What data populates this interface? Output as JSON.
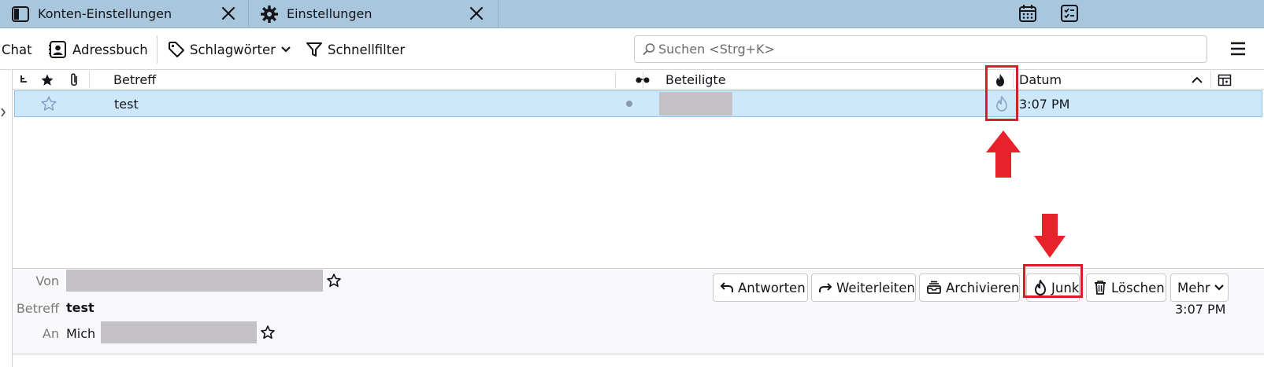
{
  "tabs": [
    {
      "label": "Konten-Einstellungen",
      "icon": "address-book-icon"
    },
    {
      "label": "Einstellungen",
      "icon": "gear-icon"
    }
  ],
  "toolbar": {
    "chat_label": "Chat",
    "addressbook_label": "Adressbuch",
    "tags_label": "Schlagwörter",
    "quickfilter_label": "Schnellfilter",
    "search_placeholder": "Suchen <Strg+K>"
  },
  "thread_columns": {
    "subject": "Betreff",
    "correspondents": "Beteiligte",
    "date": "Datum"
  },
  "messages": [
    {
      "subject": "test",
      "correspondent": "",
      "date": "3:07 PM",
      "starred": false,
      "read": false
    }
  ],
  "message_header": {
    "from_label": "Von",
    "subject_label": "Betreff",
    "subject_value": "test",
    "to_label": "An",
    "to_value": "Mich",
    "time": "3:07 PM"
  },
  "actions": {
    "reply": "Antworten",
    "forward": "Weiterleiten",
    "archive": "Archivieren",
    "junk": "Junk",
    "delete": "Löschen",
    "more": "Mehr"
  },
  "colors": {
    "tabbar": "#a9c7dc",
    "selected_row": "#cde8fb",
    "annotation_red": "#d3202a"
  }
}
